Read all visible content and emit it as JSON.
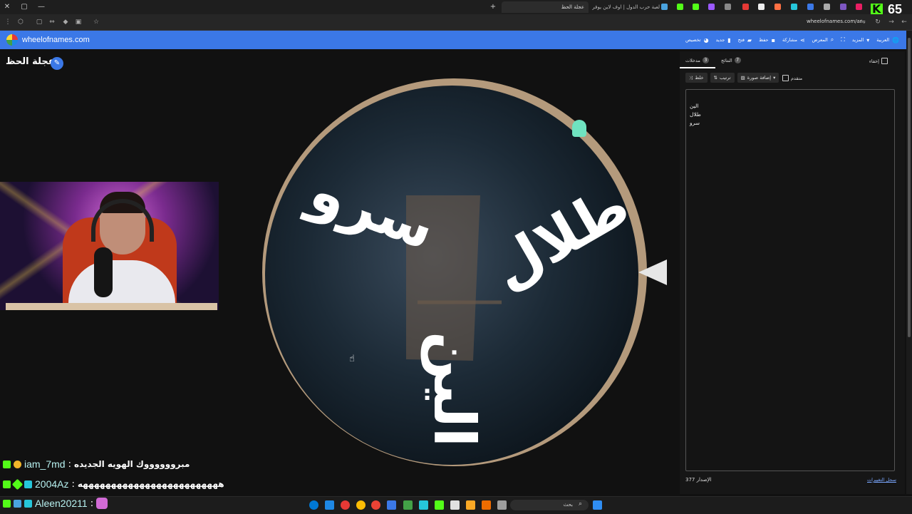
{
  "browser": {
    "active_tab": "عجلة الحظ",
    "tab2": "لعبة حرب الدول | اوف لاين يوفر",
    "url": "wheelofnames.com/ar",
    "viewer_count": "65"
  },
  "site": {
    "name": "wheelofnames.com",
    "menu": {
      "customize": "تخصيص",
      "new": "جديد",
      "open": "فتح",
      "save": "حفظ",
      "share": "مشاركة",
      "gallery": "المعرض",
      "more": "المزيد",
      "language": "العربية"
    }
  },
  "wheel": {
    "title": "عجلة الحظ",
    "segments": [
      "طلال",
      "سرو",
      "الين"
    ]
  },
  "panel": {
    "tab_entries": "مدخلات",
    "tab_entries_count": "3",
    "tab_results": "النتائج",
    "tab_results_count": "7",
    "hide": "إخفاء",
    "shuffle": "خلط",
    "sort": "ترتيب",
    "add_image": "إضافة صورة",
    "advanced": "متقدم",
    "entries": [
      "الين",
      "طلال",
      "سرو"
    ],
    "version_label": "الإصدار",
    "version_number": "377",
    "changelog": "سجل التغييرات"
  },
  "chat": [
    {
      "user": "iam_7md",
      "message": "مبرووووووك الهويه الجديده"
    },
    {
      "user": "2004Az",
      "message": "هههههههههههههههههههههههههه"
    },
    {
      "user": "Aleen20211",
      "message": ""
    }
  ],
  "taskbar": {
    "search_placeholder": "بحث"
  },
  "colors": {
    "header_blue": "#3b78e7",
    "kick_green": "#53fc18",
    "wheel_rim": "#b49a7c"
  },
  "icons": {
    "edit": "pencil-icon",
    "pointer": "wheel-pointer-icon",
    "search": "search-icon"
  }
}
